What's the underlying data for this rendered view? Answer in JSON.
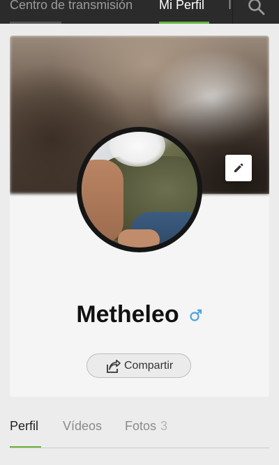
{
  "nav": {
    "tabs": [
      {
        "label": "Centro de transmisión"
      },
      {
        "label": "Mi Perfil"
      },
      {
        "label": "I"
      }
    ]
  },
  "profile": {
    "name": "Metheleo",
    "gender_symbol": "♂",
    "share_label": "Compartir"
  },
  "profile_tabs": [
    {
      "label": "Perfil"
    },
    {
      "label": "Vídeos"
    },
    {
      "label": "Fotos",
      "count": "3"
    }
  ],
  "colors": {
    "accent": "#6ab43e",
    "gender": "#4aa3df",
    "nav_bg": "#2b2b2b"
  },
  "icons": {
    "search": "search-icon",
    "edit": "pencil-icon",
    "share": "share-icon",
    "gender": "male-symbol-icon"
  }
}
